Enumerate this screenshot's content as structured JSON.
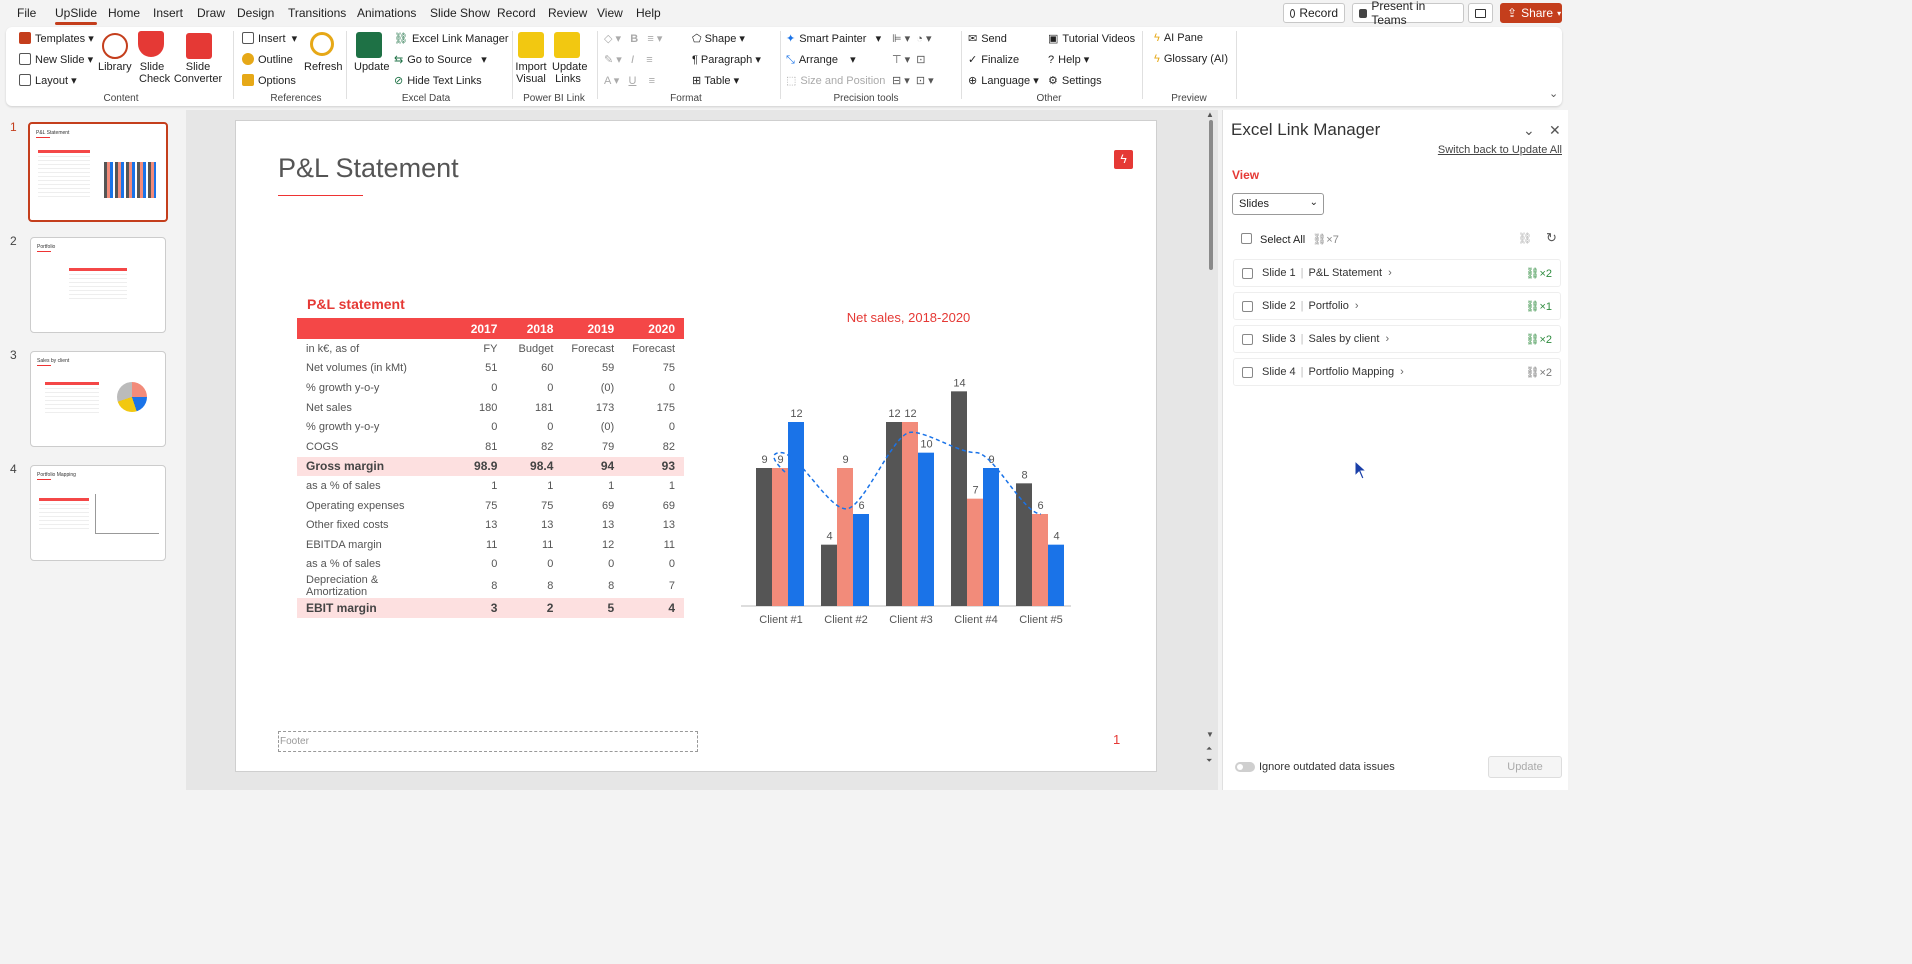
{
  "menu": {
    "items": [
      "File",
      "UpSlide",
      "Home",
      "Insert",
      "Draw",
      "Design",
      "Transitions",
      "Animations",
      "Slide Show",
      "Record",
      "Review",
      "View",
      "Help"
    ],
    "record_label": "Record",
    "present_label": "Present in Teams",
    "share_label": "Share"
  },
  "ribbon": {
    "content": {
      "templates": "Templates",
      "new_slide": "New Slide",
      "layout": "Layout",
      "library": "Library",
      "slide_check": "Slide Check",
      "slide_converter": "Slide Converter",
      "group": "Content"
    },
    "references": {
      "insert": "Insert",
      "outline": "Outline",
      "options": "Options",
      "refresh": "Refresh",
      "group": "References"
    },
    "excel": {
      "update": "Update",
      "link_manager": "Excel Link Manager",
      "go_to_source": "Go to Source",
      "hide_text_links": "Hide Text Links",
      "group": "Excel Data"
    },
    "powerbi": {
      "import_visual": "Import Visual",
      "update_links": "Update Links",
      "group": "Power BI Link"
    },
    "format": {
      "shape": "Shape",
      "paragraph": "Paragraph",
      "table": "Table",
      "group": "Format"
    },
    "precision": {
      "smart_painter": "Smart Painter",
      "arrange": "Arrange",
      "size_position": "Size and Position",
      "group": "Precision tools"
    },
    "other": {
      "send": "Send",
      "finalize": "Finalize",
      "language": "Language",
      "tutorial": "Tutorial Videos",
      "help": "Help",
      "settings": "Settings",
      "group": "Other"
    },
    "preview": {
      "ai_pane": "AI Pane",
      "glossary": "Glossary (AI)",
      "group": "Preview"
    }
  },
  "thumbnails": [
    {
      "num": "1",
      "title": "P&L Statement"
    },
    {
      "num": "2",
      "title": "Portfolio"
    },
    {
      "num": "3",
      "title": "Sales by client"
    },
    {
      "num": "4",
      "title": "Portfolio Mapping"
    }
  ],
  "slide": {
    "title": "P&L Statement",
    "table_title": "P&L statement",
    "footer": "Footer",
    "page_number": "1",
    "table": {
      "header": [
        "",
        "2017",
        "2018",
        "2019",
        "2020"
      ],
      "rows": [
        [
          "in k€, as of",
          "FY",
          "Budget",
          "Forecast",
          "Forecast"
        ],
        [
          "Net volumes (in kMt)",
          "51",
          "60",
          "59",
          "75"
        ],
        [
          "% growth y-o-y",
          "0",
          "0",
          "(0)",
          "0"
        ],
        [
          "Net sales",
          "180",
          "181",
          "173",
          "175"
        ],
        [
          "% growth y-o-y",
          "0",
          "0",
          "(0)",
          "0"
        ],
        [
          "COGS",
          "81",
          "82",
          "79",
          "82"
        ],
        [
          "Gross margin",
          "98.9",
          "98.4",
          "94",
          "93"
        ],
        [
          "as a % of sales",
          "1",
          "1",
          "1",
          "1"
        ],
        [
          "Operating expenses",
          "75",
          "75",
          "69",
          "69"
        ],
        [
          "Other fixed costs",
          "13",
          "13",
          "13",
          "13"
        ],
        [
          "EBITDA margin",
          "11",
          "11",
          "12",
          "11"
        ],
        [
          "as a % of sales",
          "0",
          "0",
          "0",
          "0"
        ],
        [
          "Depreciation & Amortization",
          "8",
          "8",
          "8",
          "7"
        ],
        [
          "EBIT margin",
          "3",
          "2",
          "5",
          "4"
        ]
      ],
      "highlight_rows": [
        6,
        13
      ]
    }
  },
  "chart_data": {
    "type": "bar",
    "title": "Net sales, 2018-2020",
    "categories": [
      "Client #1",
      "Client #2",
      "Client #3",
      "Client #4",
      "Client #5"
    ],
    "series": [
      {
        "values": [
          9,
          4,
          12,
          14,
          8
        ],
        "color": "#555555"
      },
      {
        "values": [
          9,
          9,
          12,
          7,
          6
        ],
        "color": "#f28b7a"
      },
      {
        "values": [
          12,
          6,
          10,
          9,
          4
        ],
        "color": "#1a73e8"
      }
    ],
    "trendline": {
      "style": "dashed",
      "color": "#1a73e8"
    },
    "ylim": [
      0,
      15
    ],
    "xlabel": "",
    "ylabel": ""
  },
  "pane": {
    "title": "Excel Link Manager",
    "switch_link": "Switch back to Update All",
    "view_label": "View",
    "view_value": "Slides",
    "select_all": "Select All",
    "select_all_count": "×7",
    "slides": [
      {
        "slide": "Slide 1",
        "name": "P&L Statement",
        "count": "×2",
        "status": "green"
      },
      {
        "slide": "Slide 2",
        "name": "Portfolio",
        "count": "×1",
        "status": "green"
      },
      {
        "slide": "Slide 3",
        "name": "Sales by client",
        "count": "×2",
        "status": "green"
      },
      {
        "slide": "Slide 4",
        "name": "Portfolio Mapping",
        "count": "×2",
        "status": "grey"
      }
    ],
    "ignore_label": "Ignore outdated data issues",
    "update_label": "Update"
  }
}
